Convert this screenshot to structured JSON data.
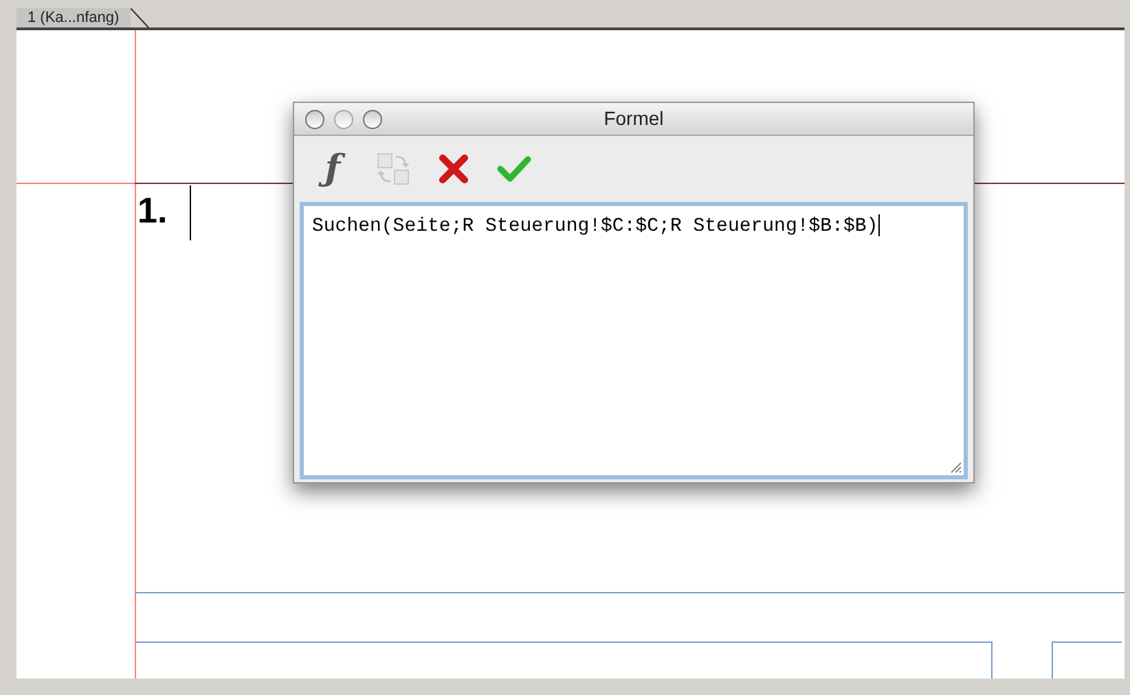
{
  "document_tab": {
    "label": "1 (Ka...nfang)",
    "selected": true
  },
  "page": {
    "list_number": "1."
  },
  "dialog": {
    "title": "Formel",
    "toolbar": [
      {
        "kind": "function",
        "label": "ƒ",
        "disabled": false
      },
      {
        "kind": "swap",
        "disabled": true
      },
      {
        "kind": "cancel",
        "disabled": false
      },
      {
        "kind": "confirm",
        "disabled": false
      }
    ],
    "formula": {
      "value": "Suchen(Seite;R Steuerung!$C:$C;R Steuerung!$B:$B)"
    }
  }
}
